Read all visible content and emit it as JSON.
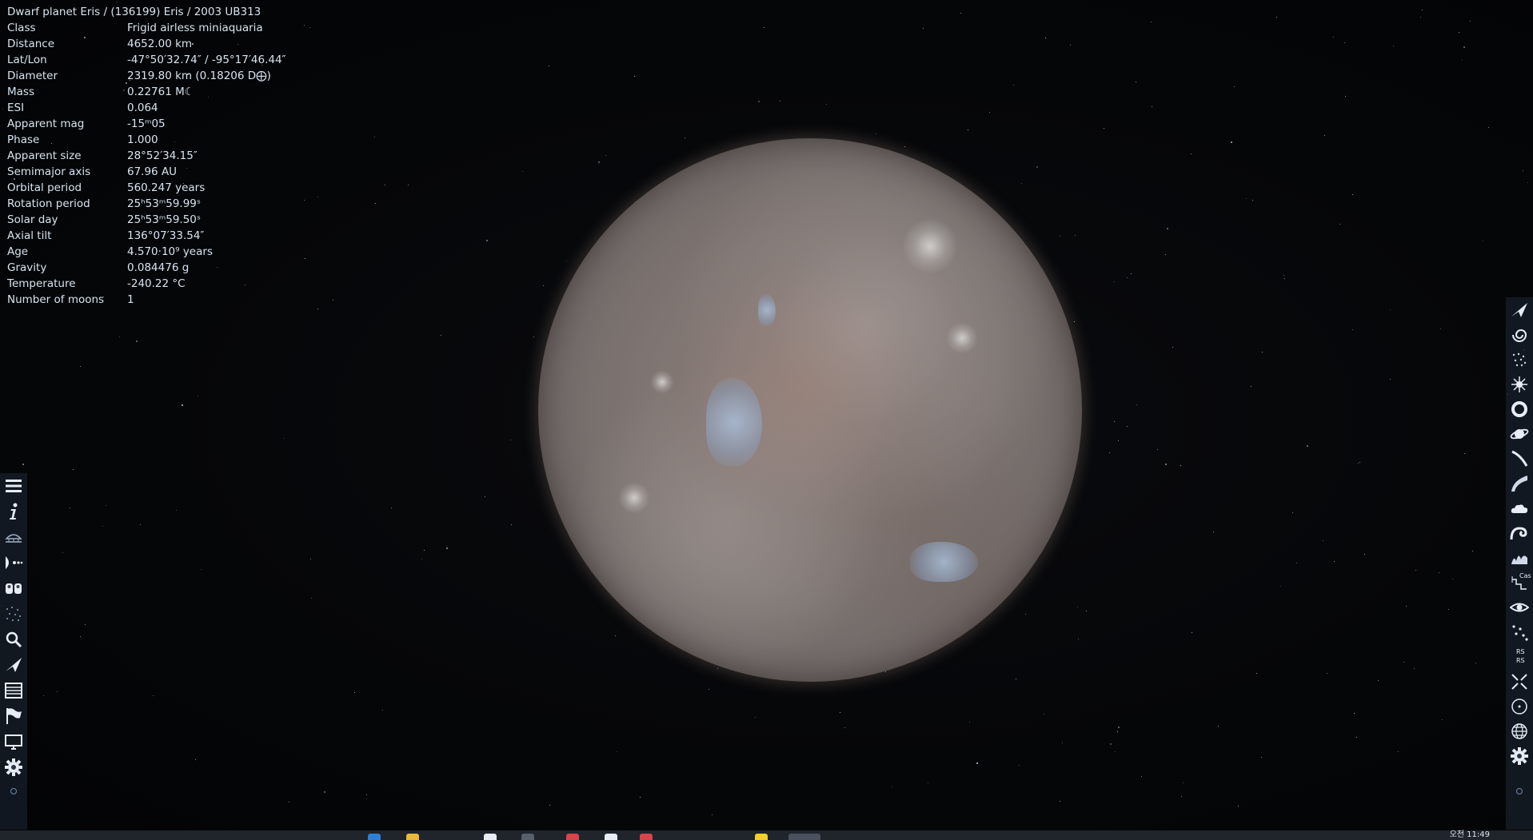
{
  "info": {
    "title": "Dwarf planet  Eris / (136199) Eris / 2003 UB313",
    "rows": [
      {
        "key": "Class",
        "value": "Frigid airless miniaquaria"
      },
      {
        "key": "Distance",
        "value": "4652.00 km"
      },
      {
        "key": "Lat/Lon",
        "value": "-47°50′32.74″ / -95°17′46.44″"
      },
      {
        "key": "Diameter",
        "value": "2319.80 km (0.18206 D⨁)"
      },
      {
        "key": "Mass",
        "value": "0.22761 M☾"
      },
      {
        "key": "ESI",
        "value": "0.064"
      },
      {
        "key": "Apparent mag",
        "value": "-15ᵐ05"
      },
      {
        "key": "Phase",
        "value": "1.000"
      },
      {
        "key": "Apparent size",
        "value": "28°52′34.15″"
      },
      {
        "key": "Semimajor axis",
        "value": "67.96 AU"
      },
      {
        "key": "Orbital period",
        "value": "560.247 years"
      },
      {
        "key": "Rotation period",
        "value": "25ʰ53ᵐ59.99ˢ"
      },
      {
        "key": "Solar day",
        "value": "25ʰ53ᵐ59.50ˢ"
      },
      {
        "key": "Axial tilt",
        "value": "136°07′33.54″"
      },
      {
        "key": "Age",
        "value": "4.570·10⁹ years"
      },
      {
        "key": "Gravity",
        "value": "0.084476 g"
      },
      {
        "key": "Temperature",
        "value": "-240.22 °C"
      },
      {
        "key": "Number of moons",
        "value": "1"
      }
    ]
  },
  "left_toolbar": {
    "items": [
      "menu-icon",
      "info-icon",
      "observatory-icon",
      "solar-system-icon",
      "star-browser-icon",
      "star-field-icon",
      "search-icon",
      "spaceship-icon",
      "catalog-icon",
      "flag-icon",
      "display-icon",
      "gear-icon"
    ]
  },
  "right_toolbar": {
    "items": [
      "spaceship-icon",
      "galaxy-icon",
      "star-cluster-icon",
      "nebula-icon",
      "ring-icon",
      "planet-ring-icon",
      "comet-icon",
      "atmosphere-icon",
      "cloud-icon",
      "wave-icon",
      "aurora-icon",
      "constellation-icon",
      "eye-icon",
      "stars-icon",
      "rs-icon",
      "collapse-icon",
      "orbit-icon",
      "globe-icon",
      "gear-icon"
    ],
    "label_cas": "Cas",
    "label_rs": "RS"
  },
  "taskbar": {
    "clock": "오전 11:49"
  },
  "colors": {
    "text": "#d6e4f2",
    "toolbar_bg": "#1e2837",
    "planet": "#7d7673"
  }
}
